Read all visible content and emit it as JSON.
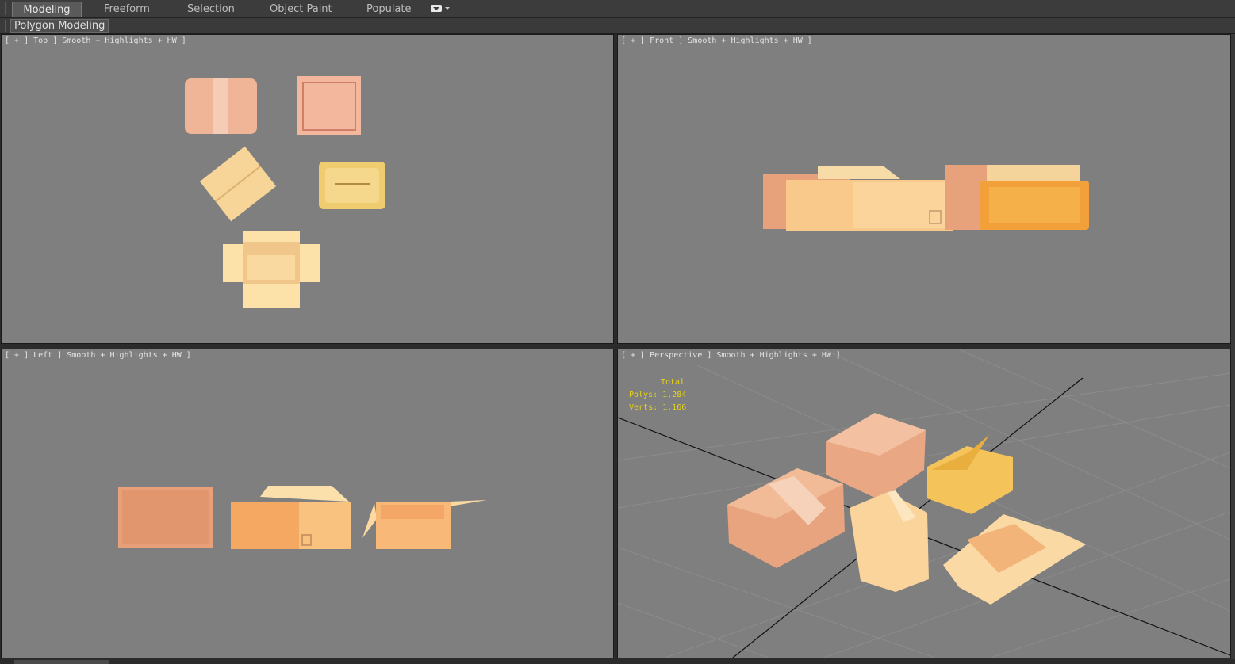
{
  "ribbon": {
    "tabs": [
      {
        "label": "Modeling",
        "active": true
      },
      {
        "label": "Freeform",
        "active": false
      },
      {
        "label": "Selection",
        "active": false
      },
      {
        "label": "Object Paint",
        "active": false
      },
      {
        "label": "Populate",
        "active": false
      }
    ],
    "panel_button": "Polygon Modeling"
  },
  "viewports": {
    "top": {
      "label": "[ + ] Top ] Smooth + Highlights + HW ]"
    },
    "front": {
      "label": "[ + ] Front ] Smooth + Highlights + HW ]"
    },
    "left": {
      "label": "[ + ] Left ] Smooth + Highlights + HW ]"
    },
    "perspective": {
      "label": "[ + ] Perspective ] Smooth + Highlights + HW ]",
      "stats": {
        "title": "Total",
        "polys": "Polys: 1,284",
        "verts": "Verts: 1,166"
      }
    }
  },
  "colors": {
    "viewport_bg": "#7f7f7f",
    "stats_text": "#e6d21a",
    "box_light": "#f6d49a",
    "box_orange": "#f2a85a",
    "box_pink": "#e8a888"
  }
}
